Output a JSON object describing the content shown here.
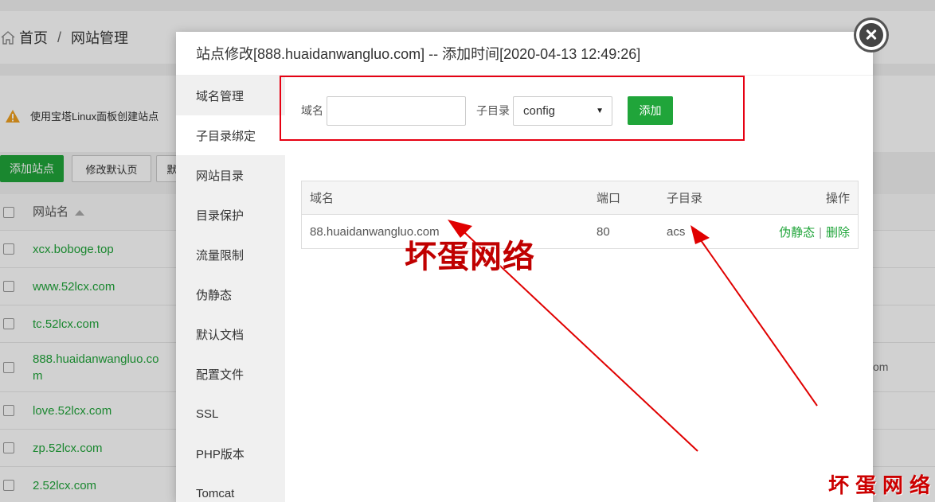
{
  "background": {
    "breadcrumb": {
      "home": "首页",
      "separator": "/",
      "current": "网站管理"
    },
    "notice": "使用宝塔Linux面板创建站点",
    "buttons": {
      "add_site": "添加站点",
      "edit_default_page": "修改默认页",
      "default_site_partial": "默"
    },
    "table": {
      "header": "网站名",
      "rows": [
        "xcx.boboge.top",
        "www.52lcx.com",
        "tc.52lcx.com",
        "888.huaidanwangluo.com",
        "love.52lcx.com",
        "zp.52lcx.com",
        "2.52lcx.com"
      ]
    },
    "right_fragment": "om"
  },
  "modal": {
    "title": "站点修改[888.huaidanwangluo.com] -- 添加时间[2020-04-13 12:49:26]",
    "nav": [
      "域名管理",
      "子目录绑定",
      "网站目录",
      "目录保护",
      "流量限制",
      "伪静态",
      "默认文档",
      "配置文件",
      "SSL",
      "PHP版本",
      "Tomcat"
    ],
    "active_nav": "子目录绑定",
    "form": {
      "domain_label": "域名",
      "domain_value": "",
      "subdir_label": "子目录",
      "subdir_selected": "config",
      "add_label": "添加"
    },
    "table": {
      "columns": [
        "域名",
        "端口",
        "子目录",
        "操作"
      ],
      "rows": [
        {
          "domain": "88.huaidanwangluo.com",
          "port": "80",
          "subdir": "acs",
          "op_rewrite": "伪静态",
          "op_sep": "|",
          "op_delete": "删除"
        }
      ]
    }
  },
  "annotation": {
    "text": "坏蛋网络",
    "watermark": "坏蛋网络",
    "color": "#c00000",
    "box_color": "#e60012"
  },
  "colors": {
    "accent": "#20a53a"
  }
}
